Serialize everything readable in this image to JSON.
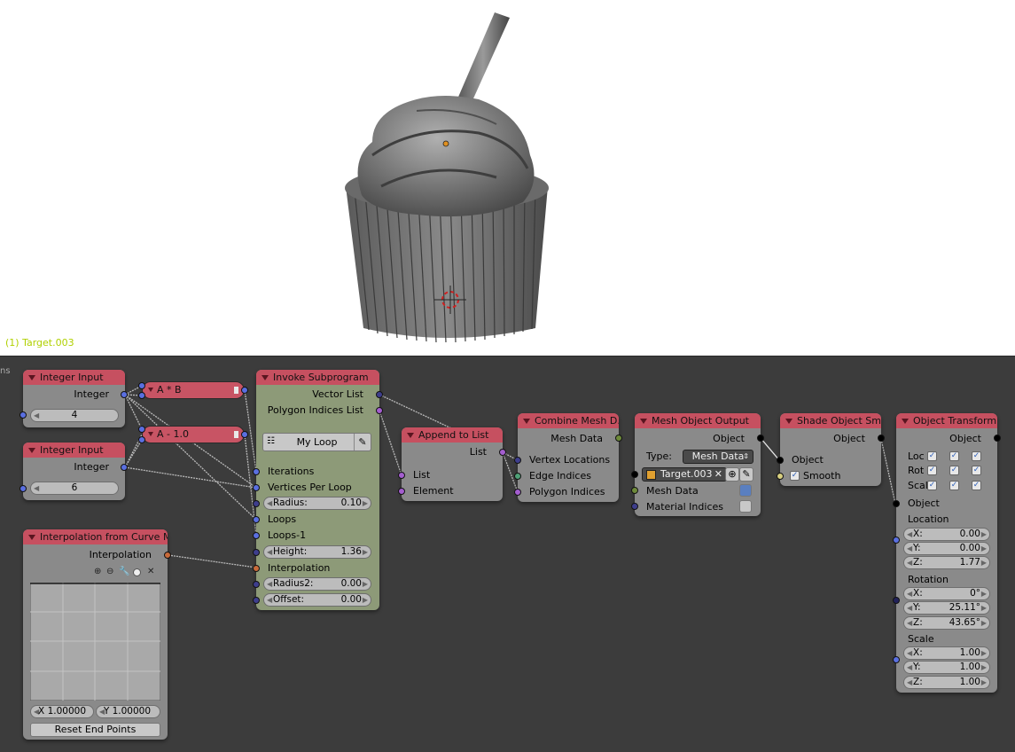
{
  "viewport": {
    "object_label": "(1) Target.003",
    "edge_text": "ns"
  },
  "nodes": {
    "int1": {
      "title": "Integer Input",
      "output": "Integer",
      "value": "4"
    },
    "int2": {
      "title": "Integer Input",
      "output": "Integer",
      "value": "6"
    },
    "op_mul": {
      "label": "A * B"
    },
    "op_sub": {
      "label": "A - 1.0"
    },
    "curve": {
      "title": "Interpolation from Curve Ma",
      "output": "Interpolation",
      "x_field": "X 1.00000",
      "y_field": "Y 1.00000",
      "reset_button": "Reset End Points"
    },
    "invoke": {
      "title": "Invoke Subprogram",
      "outputs": [
        "Vector List",
        "Polygon Indices List"
      ],
      "program_name": "My Loop",
      "inputs": {
        "iterations": "Iterations",
        "vertices_per_loop": "Vertices Per Loop",
        "radius_label": "Radius:",
        "radius_value": "0.10",
        "loops": "Loops",
        "loops_minus_1": "Loops-1",
        "height_label": "Height:",
        "height_value": "1.36",
        "interpolation": "Interpolation",
        "radius2_label": "Radius2:",
        "radius2_value": "0.00",
        "offset_label": "Offset:",
        "offset_value": "0.00"
      }
    },
    "append": {
      "title": "Append to List",
      "output": "List",
      "inputs": [
        "List",
        "Element"
      ]
    },
    "combine": {
      "title": "Combine Mesh D...",
      "output": "Mesh Data",
      "inputs": [
        "Vertex Locations",
        "Edge Indices",
        "Polygon Indices"
      ]
    },
    "mesh_out": {
      "title": "Mesh Object Output",
      "output": "Object",
      "type_label": "Type:",
      "type_value": "Mesh Data",
      "object_name": "Target.003",
      "inputs": [
        "Mesh Data",
        "Material Indices"
      ]
    },
    "shade": {
      "title": "Shade Object Sm...",
      "output": "Object",
      "input": "Object",
      "smooth_label": "Smooth"
    },
    "transform": {
      "title": "Object Transform...",
      "output": "Object",
      "flags": [
        "Loc",
        "Rot",
        "Scal"
      ],
      "input": "Object",
      "location": {
        "header": "Location",
        "x": "0.00",
        "y": "0.00",
        "z": "1.77"
      },
      "rotation": {
        "header": "Rotation",
        "x": "0°",
        "y": "25.11°",
        "z": "43.65°"
      },
      "scale": {
        "header": "Scale",
        "x": "1.00",
        "y": "1.00",
        "z": "1.00"
      },
      "axis_labels": [
        "X:",
        "Y:",
        "Z:"
      ]
    }
  },
  "colors": {
    "node_header": "#c65060",
    "socket_vector": "#5a6fe0",
    "socket_list": "#a45ecf",
    "viewport_label": "#b0d000",
    "editor_bg": "#3c3c3c"
  }
}
